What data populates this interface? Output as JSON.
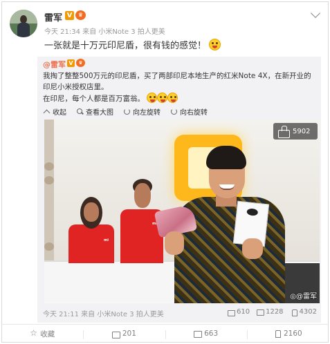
{
  "post": {
    "author": "雷军",
    "v_badge": "V",
    "meta": "今天 21:34 来自 小米Note 3 拍人更美",
    "text": "一张就是十万元印尼盾，很有钱的感觉！"
  },
  "repost": {
    "author": "@雷军",
    "text_line1": "我掏了整整500万元的印尼盾，买了两部印尼本地生产的红米Note 4X，在新开业的印尼小米授权店里。",
    "text_line2": "在印尼，每个人都是百万富翁。",
    "actions": {
      "collapse": "收起",
      "view_large": "查看大图",
      "rotate_left": "向左旋转",
      "rotate_right": "向右旋转"
    },
    "photo": {
      "like_count": "5902",
      "watermark": "@雷军",
      "staff_shirt_text": "mi"
    },
    "footer": {
      "meta": "今天 21:11 来自 小米Note 3 拍人更美",
      "shares": "610",
      "comments": "1228",
      "likes": "4302"
    }
  },
  "bottom_bar": {
    "favorite": "收藏",
    "shares": "201",
    "comments": "663",
    "likes": "2160"
  },
  "colors": {
    "link_orange": "#eb7350",
    "v_badge": "#f39800",
    "repost_bg": "#f2f2f5",
    "muted": "#999999"
  }
}
